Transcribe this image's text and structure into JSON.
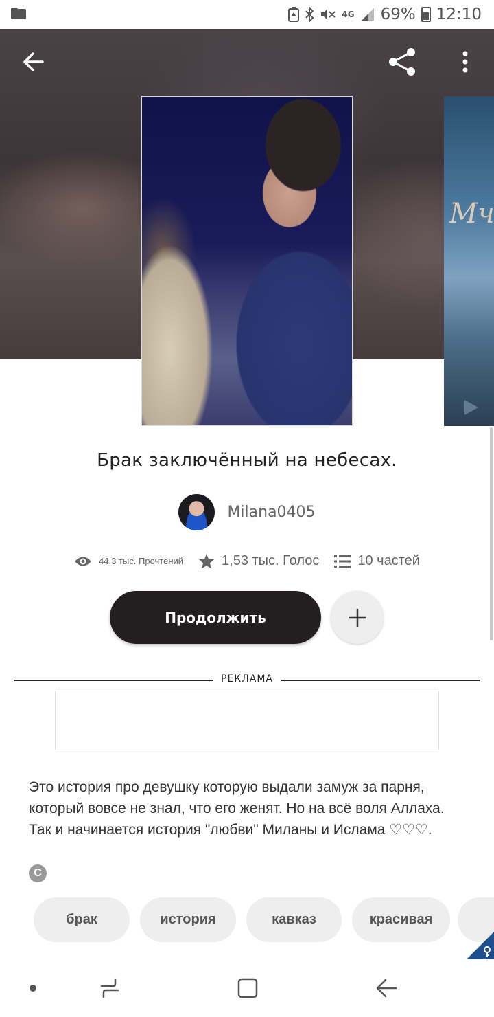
{
  "status_bar": {
    "network": "4G",
    "battery": "69%",
    "time": "12:10"
  },
  "header": {
    "back_icon": "arrow-left-icon",
    "share_icon": "share-icon",
    "more_icon": "more-vertical-icon"
  },
  "story": {
    "title": "Брак заключённый на небесах.",
    "author": "Milana0405",
    "reads": "44,3 тыс. Прочтений",
    "votes": "1,53 тыс. Голос",
    "parts": "10 частей",
    "continue_label": "Продолжить",
    "add_icon": "plus-icon",
    "ad_label": "РЕКЛАМА",
    "description": [
      "Это история про девушку которую выдали замуж за парня,",
      "который вовсе не знал, что его женят. Но на всё воля Аллаха.",
      "Так и начинается история \"любви\" Миланы и Ислама ♡♡♡."
    ],
    "copyright_symbol": "C",
    "tags": [
      "брак",
      "история",
      "кавказ",
      "красивая"
    ]
  },
  "next_cover_text": "Мч",
  "navbar": {
    "items": [
      "dot-icon",
      "recent-apps-icon",
      "home-icon",
      "back-icon"
    ]
  }
}
